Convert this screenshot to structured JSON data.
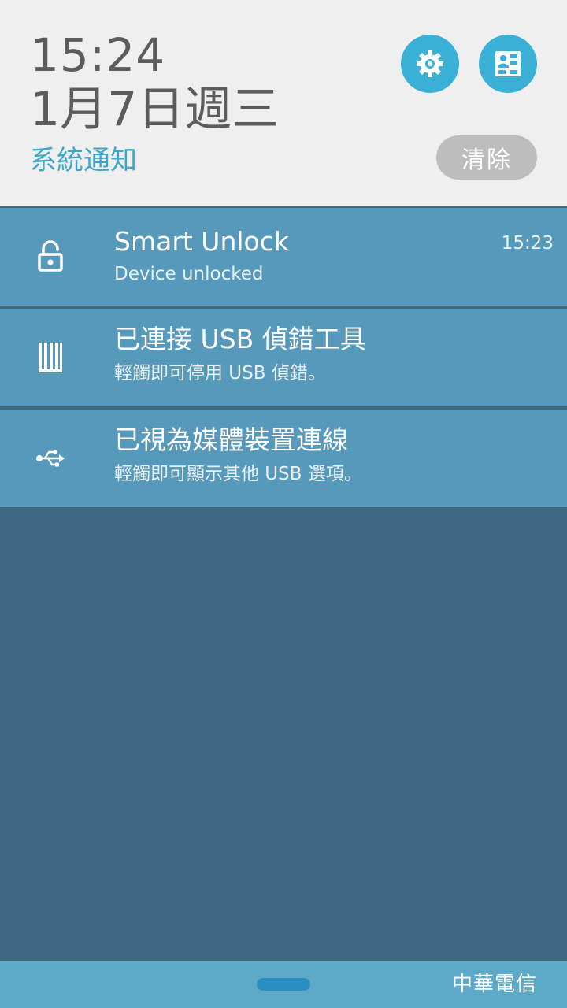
{
  "header": {
    "time": "15:24",
    "date": "1月7日週三",
    "section_label": "系統通知",
    "clear_label": "清除",
    "accent": "#3bb0d6"
  },
  "notifications": [
    {
      "icon": "unlock-icon",
      "title": "Smart Unlock",
      "subtitle": "Device unlocked",
      "time": "15:23"
    },
    {
      "icon": "usb-debug-icon",
      "title": "已連接 USB 偵錯工具",
      "subtitle": "輕觸即可停用 USB 偵錯。"
    },
    {
      "icon": "usb-icon",
      "title": "已視為媒體裝置連線",
      "subtitle": "輕觸即可顯示其他 USB 選項。"
    }
  ],
  "footer": {
    "carrier": "中華電信"
  }
}
